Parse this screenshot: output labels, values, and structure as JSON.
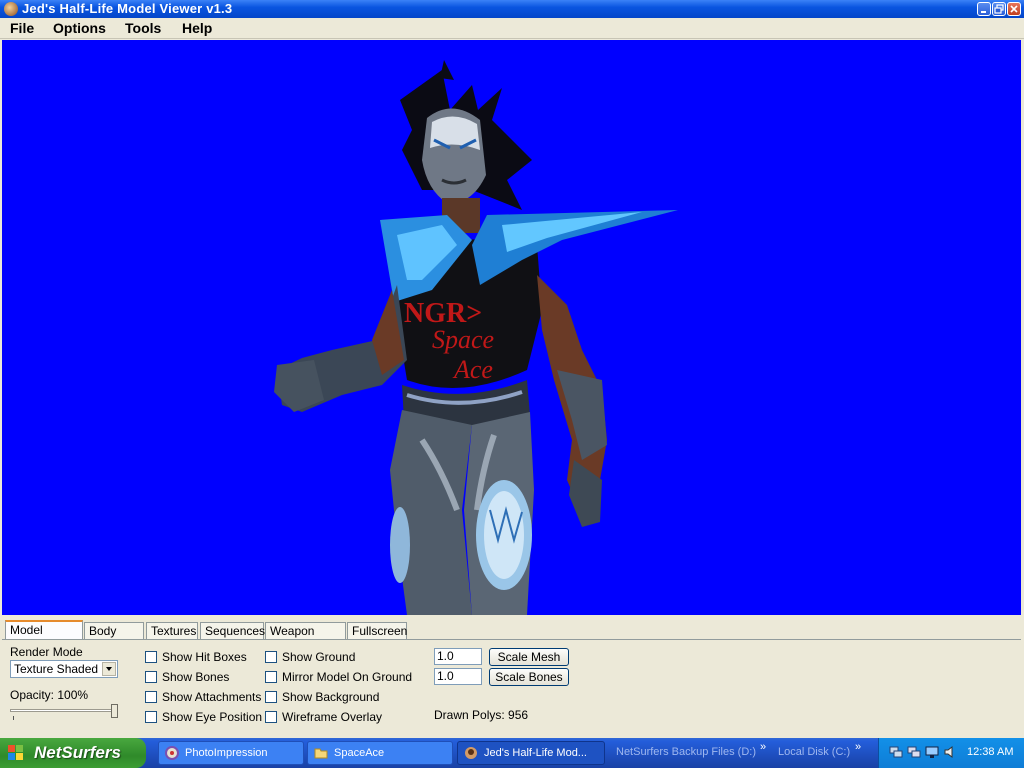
{
  "window": {
    "title": "Jed's Half-Life Model Viewer v1.3"
  },
  "menu": [
    "File",
    "Options",
    "Tools",
    "Help"
  ],
  "viewport": {
    "background": "#0000ff",
    "chest_text_1": "NGR>",
    "chest_text_2": "Space",
    "chest_text_3": "Ace"
  },
  "tabs": [
    "Model Display",
    "Body Parts",
    "Textures",
    "Sequences",
    "Weapon Origin",
    "Fullscreen"
  ],
  "panel": {
    "render_mode_label": "Render Mode",
    "render_mode_value": "Texture Shaded",
    "opacity_label": "Opacity: 100%",
    "opacity_value": 1.0,
    "checkboxes_col1": [
      "Show Hit Boxes",
      "Show Bones",
      "Show Attachments",
      "Show Eye Position"
    ],
    "checkboxes_col2": [
      "Show Ground",
      "Mirror Model On Ground",
      "Show Background",
      "Wireframe Overlay"
    ],
    "scale_mesh_value": "1.0",
    "scale_mesh_button": "Scale Mesh",
    "scale_bones_value": "1.0",
    "scale_bones_button": "Scale Bones",
    "drawn_polys": "Drawn Polys: 956"
  },
  "taskbar": {
    "start_label": "NetSurfers",
    "items": [
      {
        "label": "PhotoImpression",
        "icon": "photo-icon",
        "active": false
      },
      {
        "label": "SpaceAce",
        "icon": "folder-icon",
        "active": false
      },
      {
        "label": "Jed's Half-Life Mod...",
        "icon": "app-icon",
        "active": true
      }
    ],
    "quick": [
      "NetSurfers Backup Files (D:)",
      "Local Disk (C:)"
    ],
    "clock": "12:38 AM"
  }
}
